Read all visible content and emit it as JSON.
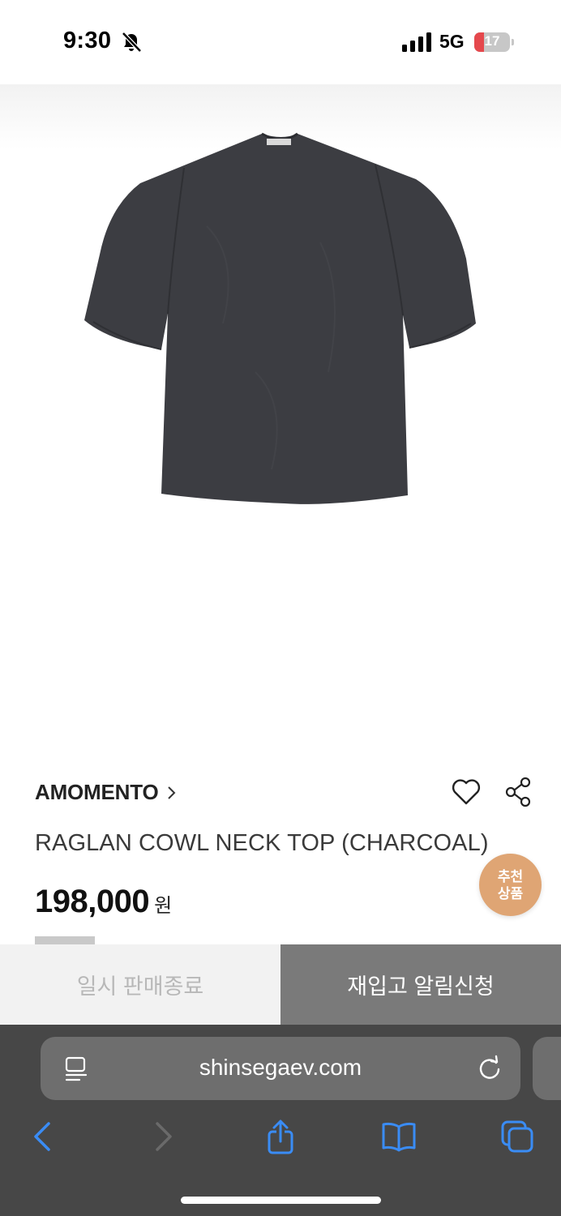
{
  "status_bar": {
    "time": "9:30",
    "network": "5G",
    "battery_level": "17",
    "icons": [
      "bell-slash-icon",
      "signal-icon",
      "battery-icon"
    ]
  },
  "product": {
    "image_alt": "charcoal raglan top",
    "brand": "AMOMENTO",
    "name": "RAGLAN COWL NECK TOP (CHARCOAL)",
    "price": "198,000",
    "currency": "원",
    "actions": [
      "heart-icon",
      "share-icon"
    ]
  },
  "recommend_badge": {
    "label": "추천 상품"
  },
  "bottom_actions": {
    "sold_out_label": "일시 판매종료",
    "restock_label": "재입고 알림신청"
  },
  "browser": {
    "url": "shinsegaev.com",
    "toolbar": [
      "back-icon",
      "forward-icon",
      "share-icon",
      "bookmarks-icon",
      "tabs-icon"
    ]
  },
  "colors": {
    "badge": "#dfa574",
    "restock_button": "#7a7a7a",
    "toolbar_accent": "#3a8cf5",
    "browser_bar": "#474747"
  }
}
